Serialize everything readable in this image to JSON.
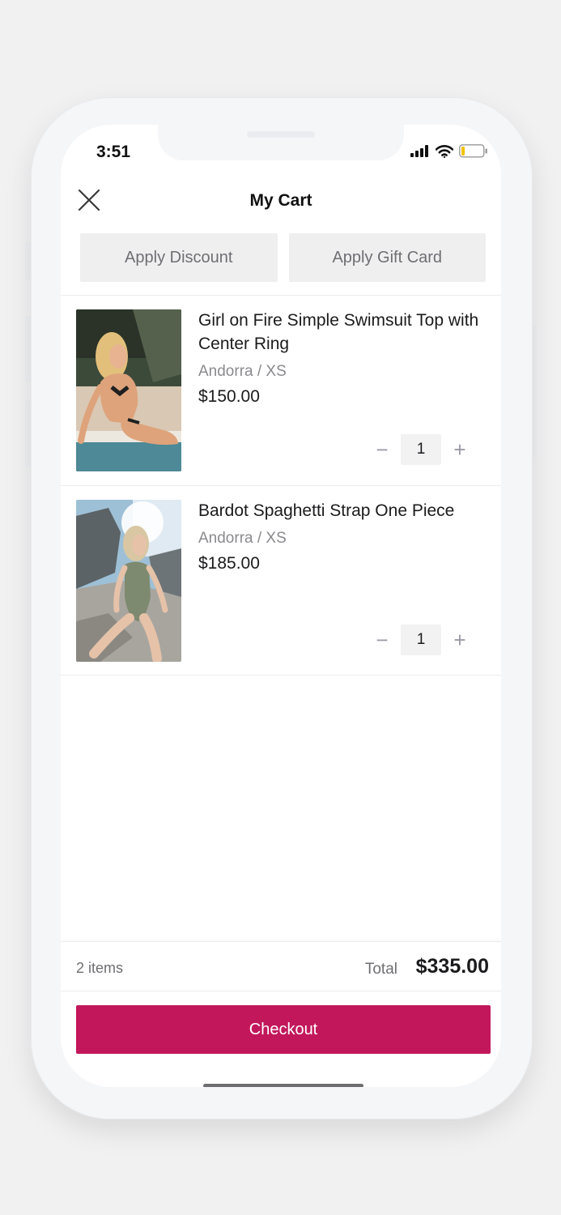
{
  "status_bar": {
    "time": "3:51",
    "icons": [
      "cellular-signal-icon",
      "wifi-icon",
      "battery-icon"
    ]
  },
  "header": {
    "title": "My Cart",
    "close_icon": "close-icon"
  },
  "promo": {
    "discount_label": "Apply Discount",
    "gift_card_label": "Apply Gift Card"
  },
  "cart": {
    "items": [
      {
        "name": "Girl on Fire Simple Swimsuit Top with Center Ring",
        "variant": "Andorra / XS",
        "price": "$150.00",
        "quantity": "1"
      },
      {
        "name": "Bardot Spaghetti Strap One Piece",
        "variant": "Andorra / XS",
        "price": "$185.00",
        "quantity": "1"
      }
    ],
    "decrement_symbol": "−",
    "increment_symbol": "+"
  },
  "summary": {
    "item_count": "2 items",
    "total_label": "Total",
    "total_value": "$335.00"
  },
  "checkout": {
    "label": "Checkout"
  },
  "colors": {
    "accent": "#c2185b",
    "background": "#f1f1f2",
    "button_gray": "#efeff0",
    "text_dark": "#1b1b1d",
    "text_muted": "#8a8a8e"
  }
}
